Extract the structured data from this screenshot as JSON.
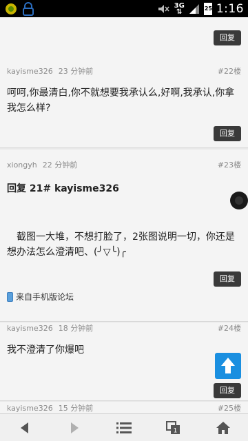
{
  "status_bar": {
    "network": "3G",
    "battery": "25",
    "time": "1:16"
  },
  "reply_label": "回复",
  "posts": [
    {
      "author": "kayisme326",
      "time": "23 分钟前",
      "floor": "#22楼",
      "text": "呵呵,你最清白,你不就想要我承认么,好啊,我承认,你拿我怎么样?"
    },
    {
      "author": "xiongyh",
      "time": "22 分钟前",
      "floor": "#23楼",
      "quote": "回复 21# kayisme326",
      "text_line1": "截图一大堆，不想打脸了，2张图说明一切，你还是",
      "text_line2": "想办法怎么澄清吧、(╯▽╰)╭",
      "source": "来自手机版论坛"
    },
    {
      "author": "kayisme326",
      "time": "18 分钟前",
      "floor": "#24楼",
      "text": "我不澄清了你爆吧"
    },
    {
      "author": "kayisme326",
      "time": "15 分钟前",
      "floor": "#25楼"
    }
  ],
  "icons": {
    "back": "left-arrow-icon",
    "forward": "right-arrow-icon",
    "menu": "list-icon",
    "windows": "windows-icon",
    "home": "home-icon",
    "scroll_top": "up-arrow-icon"
  }
}
